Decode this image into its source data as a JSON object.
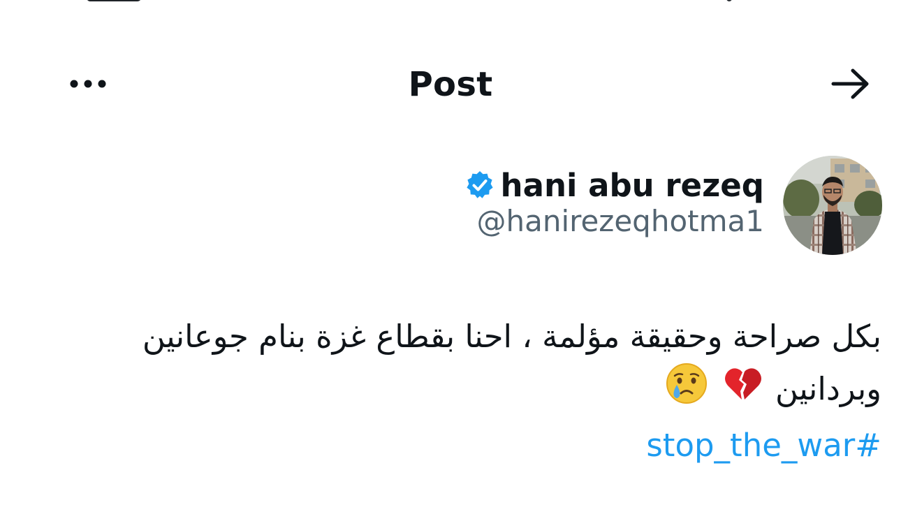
{
  "header": {
    "title": "Post",
    "more_icon": "more-horizontal-icon",
    "back_icon": "arrow-right-icon"
  },
  "author": {
    "display_name": "hani abu rezeq",
    "handle": "@hanirezeqhotma1",
    "verified": true,
    "verified_icon": "verified-badge-icon",
    "verified_color": "#1d9bf0"
  },
  "post": {
    "line1": "بكل صراحة وحقيقة مؤلمة ، احنا بقطاع غزة بنام جوعانين",
    "line2": "وبردانين",
    "emojis": [
      "broken-heart-icon",
      "crying-face-icon"
    ],
    "hashtag": "#stop_the_war",
    "hashtag_color": "#1d9bf0"
  },
  "colors": {
    "text": "#0f1419",
    "secondary": "#536471",
    "accent": "#1d9bf0",
    "background": "#ffffff"
  }
}
